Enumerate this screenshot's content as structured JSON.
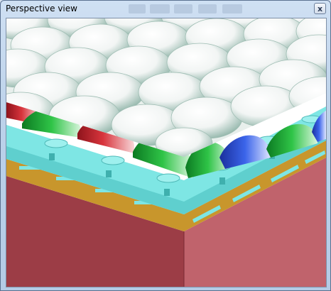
{
  "window": {
    "title": "Perspective view",
    "close_glyph": "x"
  },
  "icons": {
    "close": "close-icon"
  },
  "colors": {
    "lens_white": "#ffffff",
    "filter_red": "#c0262e",
    "filter_green": "#23b23a",
    "filter_blue": "#2d52d8",
    "layer_cyan": "#7ee6e4",
    "layer_gold": "#c8962c",
    "substrate_front": "#9c3d46",
    "substrate_side": "#c0636c"
  }
}
